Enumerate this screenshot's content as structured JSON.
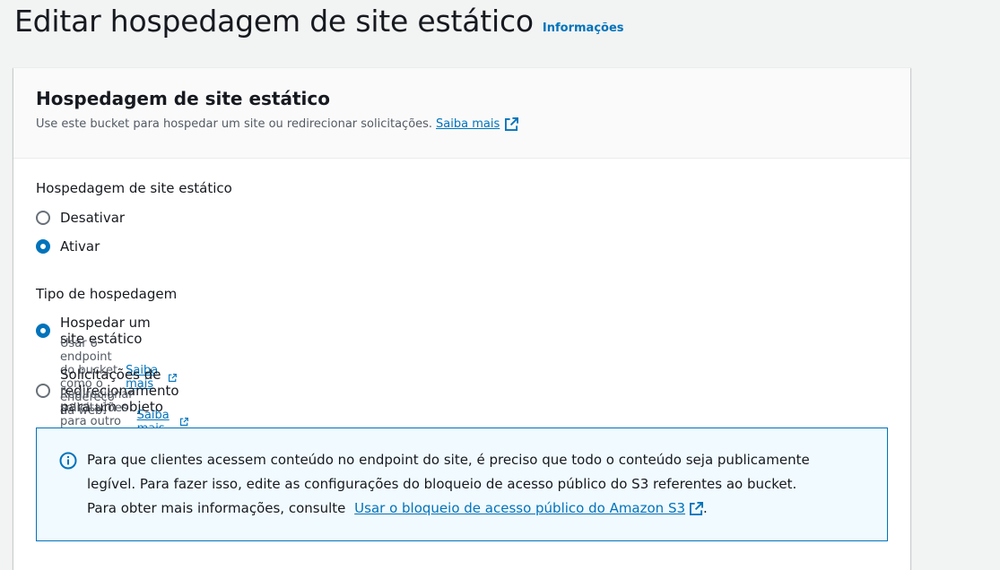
{
  "header": {
    "title": "Editar hospedagem de site estático",
    "info_link": "Informações"
  },
  "panel": {
    "title": "Hospedagem de site estático",
    "description": "Use este bucket para hospedar um site ou redirecionar solicitações.",
    "learn_more": "Saiba mais"
  },
  "hosting": {
    "label": "Hospedagem de site estático",
    "options": [
      {
        "label": "Desativar",
        "checked": false
      },
      {
        "label": "Ativar",
        "checked": true
      }
    ]
  },
  "hosting_type": {
    "label": "Tipo de hospedagem",
    "options": [
      {
        "label": "Hospedar um site estático",
        "description": "Usar o endpoint do bucket como o endereço da web.",
        "learn_more": "Saiba mais",
        "checked": true
      },
      {
        "label": "Solicitações de redirecionamento para um objeto",
        "description": "Redirecionar solicitações para outro bucket ou domínio.",
        "learn_more": "Saiba mais",
        "checked": false
      }
    ]
  },
  "alert": {
    "line1": "Para que clientes acessem conteúdo no endpoint do site, é preciso que todo o conteúdo seja publicamente",
    "line2": "legível. Para fazer isso, edite as configurações do bloqueio de acesso público do S3 referentes ao bucket.",
    "line3_prefix": "Para obter mais informações, consulte",
    "link": "Usar o bloqueio de acesso público do Amazon S3",
    "line3_suffix": "."
  },
  "colors": {
    "accent": "#0073bb",
    "alert_bg": "#f1faff",
    "page_bg": "#f2f3f3"
  }
}
